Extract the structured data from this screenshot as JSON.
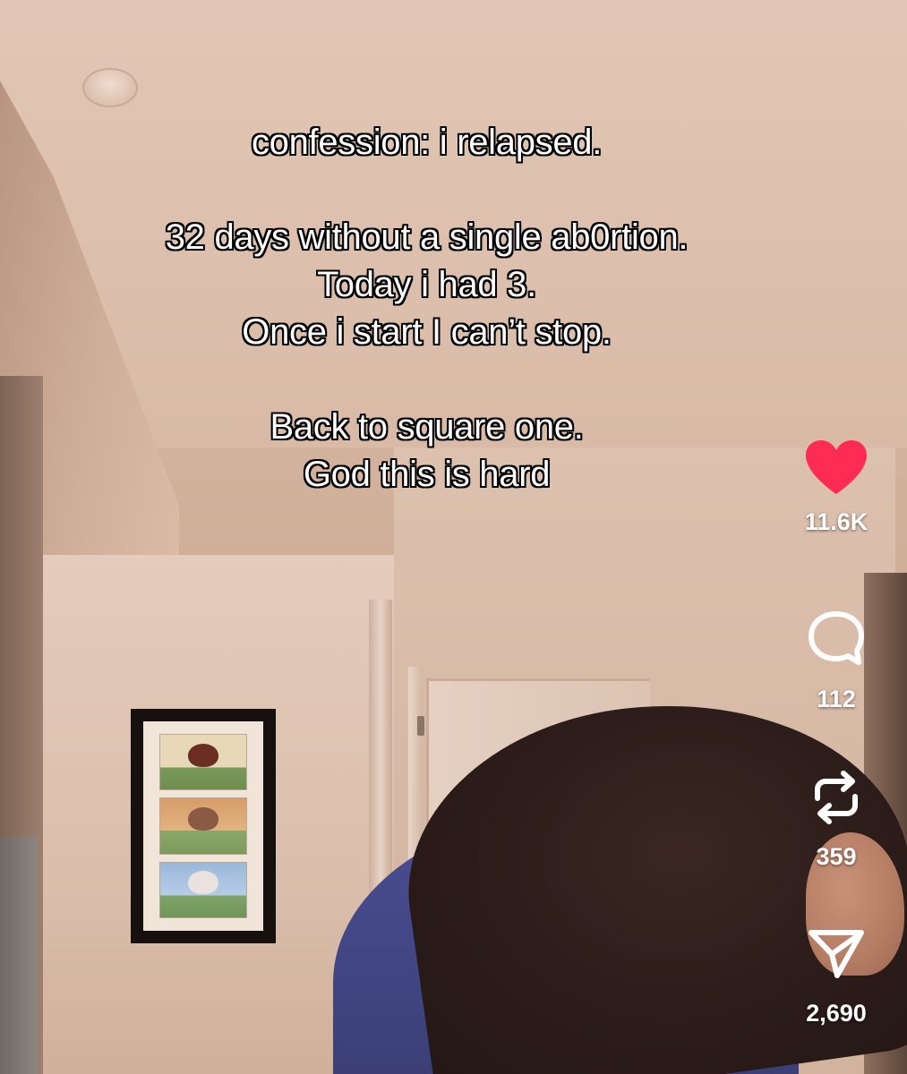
{
  "caption": {
    "line1": "confession: i relapsed.",
    "line2": "32 days without a single ab0rtion.",
    "line3": "Today i had 3.",
    "line4": "Once i start I can’t stop.",
    "line5": "Back to square one.",
    "line6": "God this is hard"
  },
  "actions": {
    "like": {
      "icon": "heart-icon",
      "count": "11.6K",
      "color": "#fe2c55"
    },
    "comment": {
      "icon": "comment-bubble-icon",
      "count": "112"
    },
    "repost": {
      "icon": "repost-icon",
      "count": "359"
    },
    "share": {
      "icon": "share-send-icon",
      "count": "2,690"
    }
  }
}
